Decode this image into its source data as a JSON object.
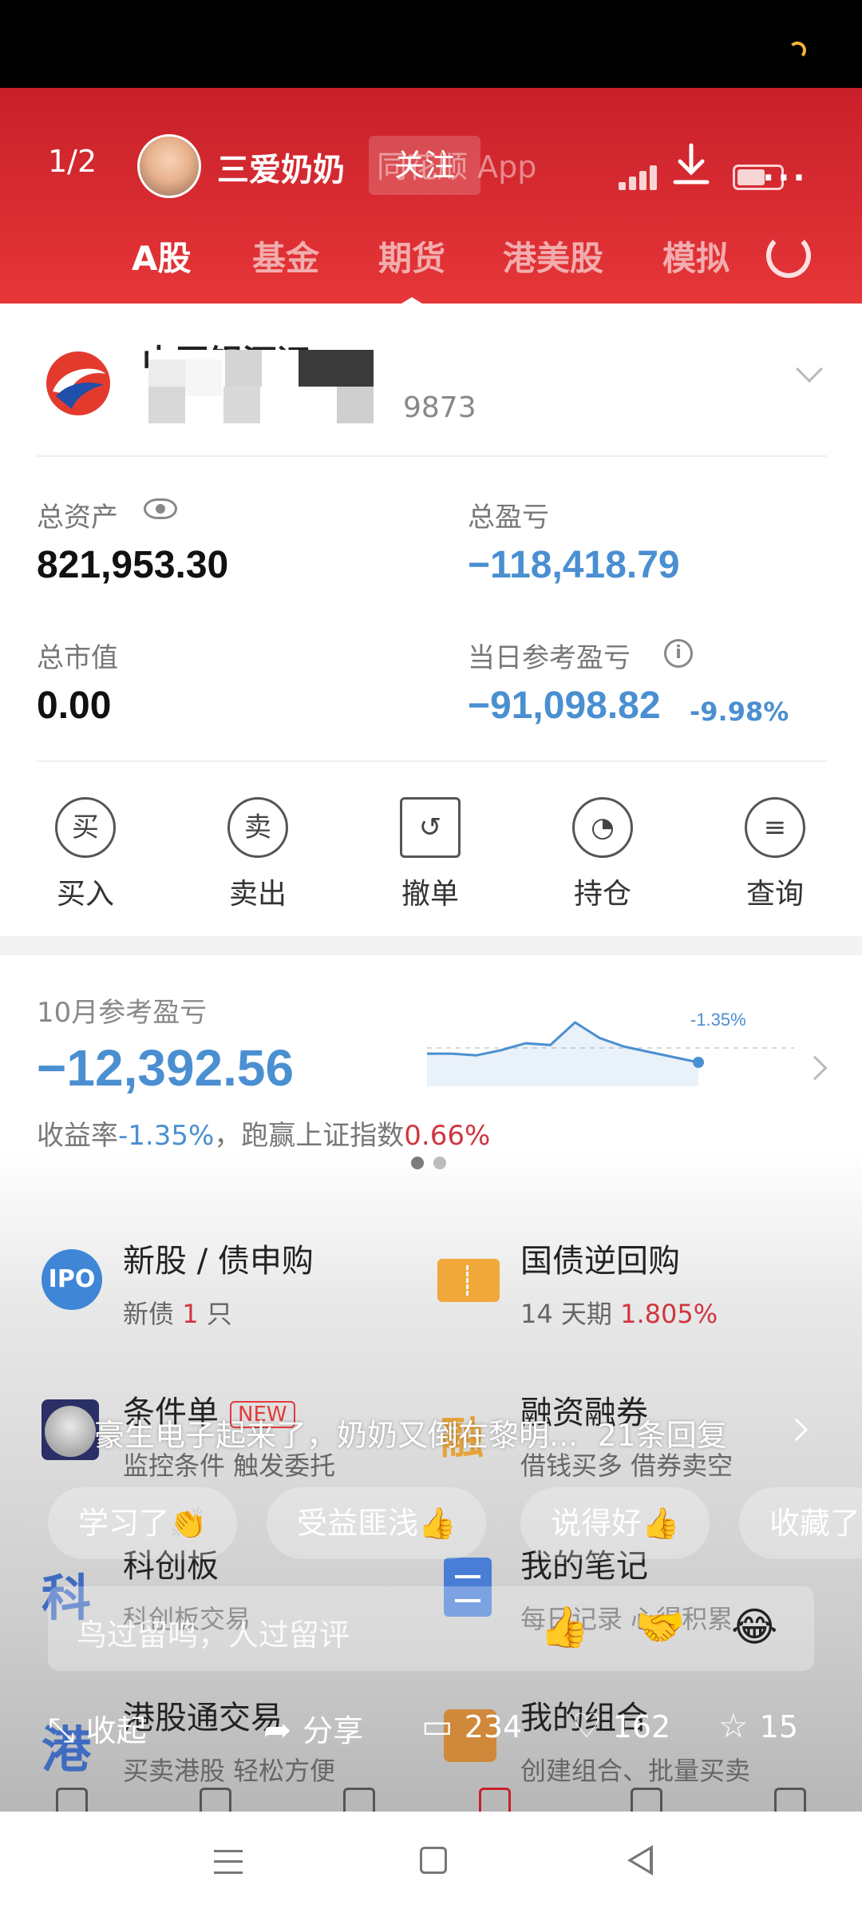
{
  "post_header": {
    "page_indicator": "1/2",
    "author_name": "三爱奶奶",
    "follow_label": "关注",
    "watermark_text": "同花顺 App"
  },
  "app_tabs": [
    "A股",
    "基金",
    "期货",
    "港美股",
    "模拟"
  ],
  "active_tab": 0,
  "account": {
    "broker_name": "中国银河证",
    "account_suffix": "9873"
  },
  "assets": {
    "total_assets_label": "总资产",
    "total_assets_value": "821,953.30",
    "total_pnl_label": "总盈亏",
    "total_pnl_value": "−118,418.79",
    "market_value_label": "总市值",
    "market_value_value": "0.00",
    "daily_pnl_label": "当日参考盈亏",
    "daily_pnl_value": "−91,098.82",
    "daily_pnl_pct": "-9.98%",
    "info_glyph": "i"
  },
  "actions": [
    {
      "glyph": "买",
      "label": "买入"
    },
    {
      "glyph": "卖",
      "label": "卖出"
    },
    {
      "glyph": "↺",
      "label": "撤单"
    },
    {
      "glyph": "◔",
      "label": "持仓"
    },
    {
      "glyph": "≡",
      "label": "查询"
    }
  ],
  "monthly": {
    "label": "10月参考盈亏",
    "value": "−12,392.56",
    "return_prefix": "收益率",
    "return_value": "-1.35%",
    "beat_prefix": "，跑赢上证指数",
    "beat_value": "0.66%",
    "spark_label": "-1.35%",
    "spark_values": [
      0.0,
      0.0,
      -0.05,
      0.1,
      0.3,
      0.25,
      0.9,
      0.45,
      0.2,
      0.05,
      -0.1,
      -0.25
    ]
  },
  "services": [
    {
      "title": "新股 / 债申购",
      "sub_prefix": "新债 ",
      "sub_highlight": "1",
      "sub_suffix": " 只",
      "icon_text": "IPO"
    },
    {
      "title": "国债逆回购",
      "sub_prefix": "14 天期 ",
      "sub_highlight": "1.805%",
      "sub_suffix": ""
    },
    {
      "title": "条件单",
      "badge": "NEW",
      "sub": "监控条件 触发委托"
    },
    {
      "title": "融资融券",
      "sub": "借钱买多 借券卖空",
      "icon_text": "融"
    },
    {
      "title": "科创板",
      "sub": "科创板交易",
      "icon_text": "科"
    },
    {
      "title": "我的笔记",
      "sub": "每日记录 心得积累"
    },
    {
      "title": "港股通交易",
      "sub": "买卖港股 轻松方便",
      "icon_text": "港"
    },
    {
      "title": "我的组合",
      "sub": "创建组合、批量买卖"
    }
  ],
  "comment_overlay": {
    "top_comment": "豪生电子起来了，奶奶又倒在黎明...",
    "replies": "21条回复",
    "quick_replies": [
      "学习了👏",
      "受益匪浅👍",
      "说得好👍",
      "收藏了"
    ],
    "input_placeholder": "鸟过留鸣，人过留评",
    "emojis": [
      "👍",
      "🤝",
      "😂"
    ]
  },
  "bottom_actions": {
    "collapse_label": "收起",
    "share_label": "分享",
    "comments_count": "234",
    "likes_count": "162",
    "favorites_count": "15"
  },
  "colors": {
    "header_red": "#e63638",
    "loss_blue": "#4a8fd1",
    "gain_red": "#d0363f"
  }
}
